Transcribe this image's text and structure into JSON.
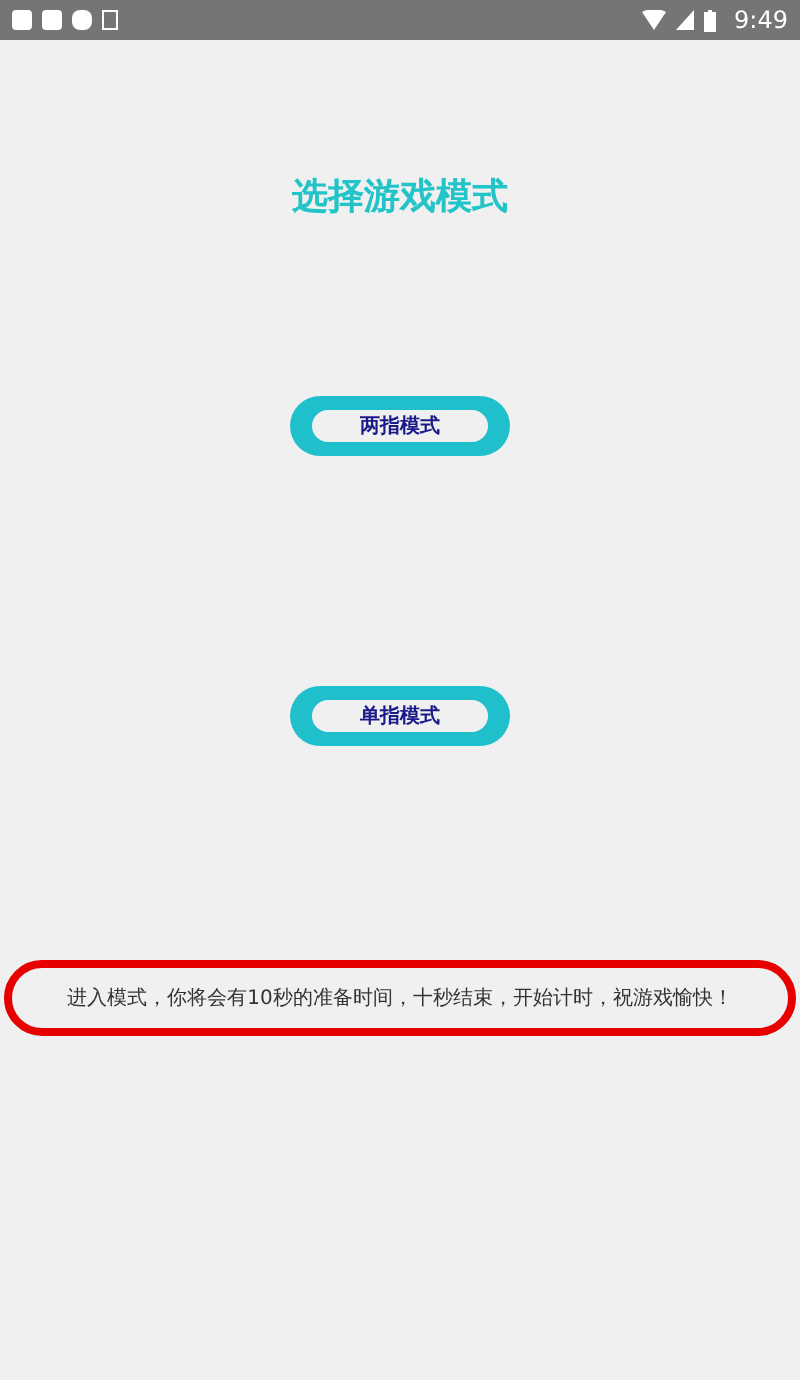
{
  "status_bar": {
    "time": "9:49"
  },
  "title": "选择游戏模式",
  "buttons": [
    "两指模式",
    "单指模式"
  ],
  "notice": "进入模式，你将会有10秒的准备时间，十秒结束，开始计时，祝游戏愉快！"
}
